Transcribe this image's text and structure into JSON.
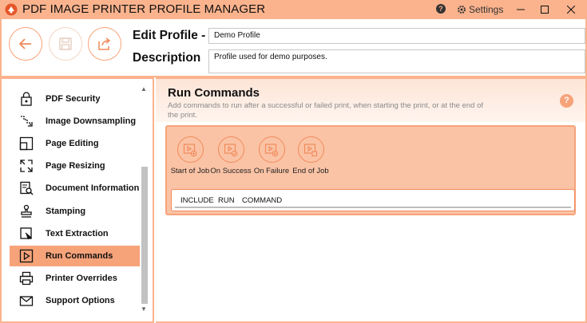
{
  "window": {
    "title": "PDF IMAGE PRINTER PROFILE MANAGER",
    "help_label": "?",
    "settings_label": "Settings"
  },
  "header": {
    "edit_profile_label": "Edit Profile -",
    "description_label": "Description",
    "profile_name": "Demo Profile",
    "profile_description": "Profile used for demo purposes."
  },
  "sidebar": {
    "items": [
      {
        "label": "PDF Security",
        "icon": "lock-icon"
      },
      {
        "label": "Image Downsampling",
        "icon": "downsample-icon"
      },
      {
        "label": "Page Editing",
        "icon": "page-edit-icon"
      },
      {
        "label": "Page Resizing",
        "icon": "resize-icon"
      },
      {
        "label": "Document Information",
        "icon": "document-info-icon"
      },
      {
        "label": "Stamping",
        "icon": "stamp-icon"
      },
      {
        "label": "Text Extraction",
        "icon": "text-extract-icon"
      },
      {
        "label": "Run Commands",
        "icon": "play-icon"
      },
      {
        "label": "Printer Overrides",
        "icon": "printer-icon"
      },
      {
        "label": "Support Options",
        "icon": "mail-icon"
      }
    ],
    "active_index": 7
  },
  "main": {
    "title": "Run Commands",
    "description": "Add commands to run after a successful or failed print, when starting the print, or at the end of the print.",
    "help_label": "?",
    "command_buttons": [
      {
        "label": "Start of Job"
      },
      {
        "label": "On Success"
      },
      {
        "label": "On Failure"
      },
      {
        "label": "End of Job"
      }
    ],
    "table_columns": [
      "INCLUDE",
      "RUN",
      "COMMAND"
    ]
  },
  "colors": {
    "accent": "#f7a37a",
    "titlebar": "#fbb38d",
    "panel": "#fbc3a5"
  }
}
